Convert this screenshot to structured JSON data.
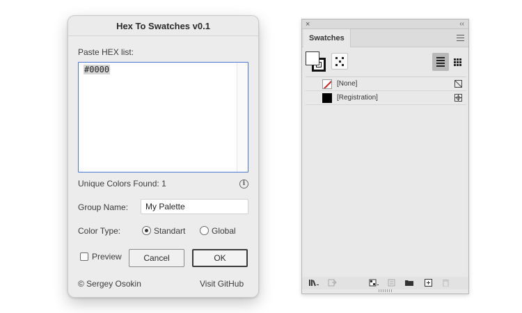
{
  "dialog": {
    "title": "Hex To Swatches v0.1",
    "paste_label": "Paste HEX list:",
    "hex_value": "#0000",
    "unique_colors_text": "Unique Colors Found: 1",
    "info_icon": "info-icon",
    "group_name_label": "Group Name:",
    "group_name_value": "My Palette",
    "color_type_label": "Color Type:",
    "color_type_options": [
      "Standart",
      "Global"
    ],
    "color_type_selected": "Standart",
    "preview_label": "Preview",
    "preview_checked": false,
    "cancel_label": "Cancel",
    "ok_label": "OK",
    "copyright": "© Sergey Osokin",
    "github_link": "Visit GitHub"
  },
  "swatches_panel": {
    "close_glyph": "×",
    "collapse_glyph": "‹‹",
    "tab_label": "Swatches",
    "menu_icon": "hamburger-menu-icon",
    "view_mode": "list",
    "swatches": [
      {
        "name": "[None]",
        "chip": "none",
        "icon": "no-print-icon"
      },
      {
        "name": "[Registration]",
        "chip": "black",
        "icon": "registration-icon"
      }
    ],
    "bottom_icons": [
      "swatch-libraries-icon",
      "place-swatch-icon",
      "show-swatch-kinds-icon",
      "swatch-options-icon",
      "new-color-group-icon",
      "new-swatch-icon",
      "delete-swatch-icon"
    ]
  },
  "colors": {
    "accent_focus": "#4a78d8",
    "none_slash": "#d02020",
    "registration": "#000000"
  }
}
